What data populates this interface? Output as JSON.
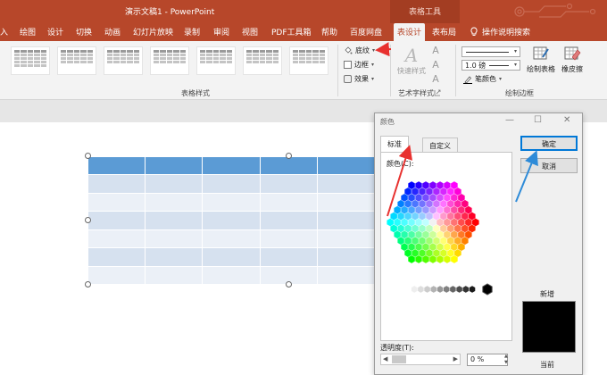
{
  "window": {
    "title": "演示文稿1  -  PowerPoint",
    "context_tab_group": "表格工具"
  },
  "tabs": [
    {
      "label": "入",
      "active": false
    },
    {
      "label": "绘图",
      "active": false
    },
    {
      "label": "设计",
      "active": false
    },
    {
      "label": "切换",
      "active": false
    },
    {
      "label": "动画",
      "active": false
    },
    {
      "label": "幻灯片放映",
      "active": false
    },
    {
      "label": "录制",
      "active": false
    },
    {
      "label": "审阅",
      "active": false
    },
    {
      "label": "视图",
      "active": false
    },
    {
      "label": "PDF工具箱",
      "active": false
    },
    {
      "label": "帮助",
      "active": false
    },
    {
      "label": "百度网盘",
      "active": false
    },
    {
      "label": "表设计",
      "active": true
    },
    {
      "label": "表布局",
      "active": false
    }
  ],
  "help": {
    "label": "操作说明搜索",
    "icon": "lightbulb-icon"
  },
  "ribbon": {
    "table_styles_label": "表格样式",
    "shading_label": "底纹",
    "borders_label": "边框",
    "effects_label": "效果",
    "quick_styles_label": "快速样式",
    "art_text_label": "艺术字样式",
    "pen_weight": "1.0 磅",
    "pen_color_label": "笔颜色",
    "draw_table_label": "绘制表格",
    "eraser_label": "橡皮擦",
    "draw_borders_label": "绘制边框"
  },
  "dialog": {
    "title": "颜色",
    "tab_standard": "标准",
    "tab_custom": "自定义",
    "colors_label": "颜色(C):",
    "ok_label": "确定",
    "cancel_label": "取消",
    "new_label": "新增",
    "current_label": "当前",
    "transparency_label": "透明度(T):",
    "transparency_value": "0 %",
    "selected_color": "#000000"
  },
  "colors": {
    "accent": "#b7472a",
    "table_header": "#5b9bd5",
    "table_band_1": "#d6e1ef",
    "table_band_2": "#ebf0f7",
    "annotation_arrow_red": "#e8312f",
    "annotation_arrow_blue": "#2e8bd8"
  }
}
